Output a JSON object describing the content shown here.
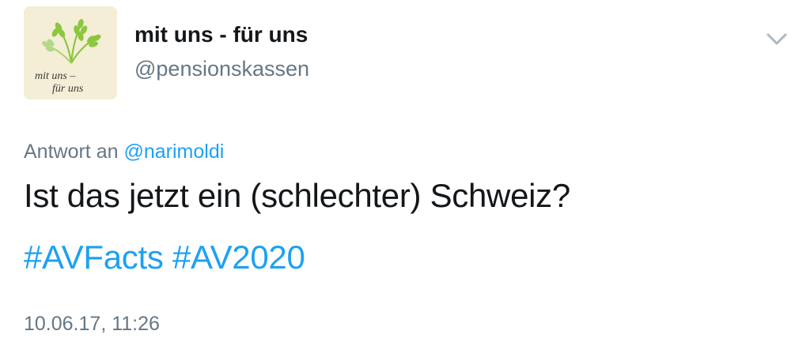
{
  "profile": {
    "display_name": "mit uns - für uns",
    "handle": "@pensionskassen",
    "avatar_text_line1": "mit uns –",
    "avatar_text_line2": "für uns"
  },
  "icons": {
    "menu": "chevron-down-icon",
    "avatar_logo": "wheat-icon"
  },
  "tweet": {
    "reply_prefix": "Antwort an",
    "reply_mention": "@narimoldi",
    "text": "Ist das jetzt ein (schlechter) Schweiz?",
    "hashtags": [
      "#AVFacts",
      "#AV2020"
    ],
    "timestamp": "10.06.17, 11:26"
  },
  "colors": {
    "link": "#1da1f2",
    "secondary_text": "#657786",
    "primary_text": "#14171a",
    "avatar_bg": "#f4eed6",
    "avatar_green": "#8cc63f"
  }
}
